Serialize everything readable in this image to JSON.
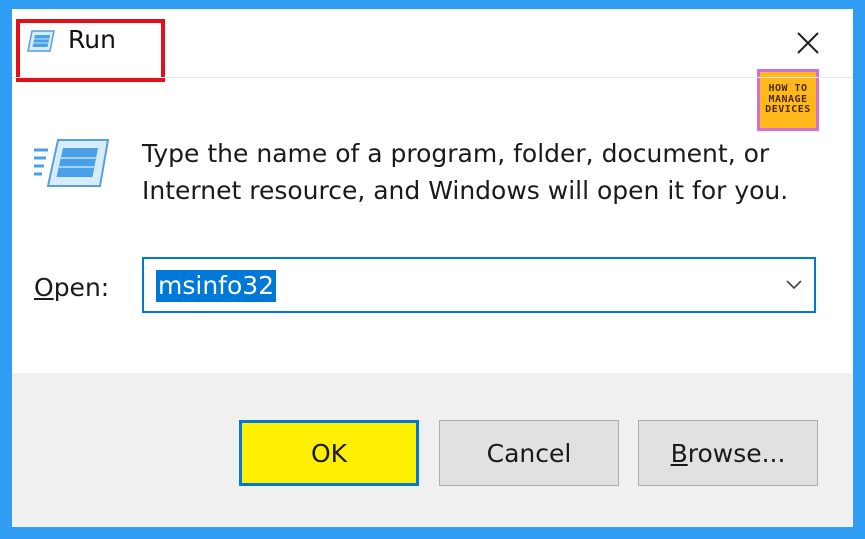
{
  "window": {
    "title": "Run",
    "close_icon": "close-icon"
  },
  "watermark": {
    "line1": "HOW TO",
    "line2": "MANAGE",
    "line3": "DEVICES"
  },
  "message": {
    "line1": "Type the name of a program, folder, document, or",
    "line2": "Internet resource, and Windows will open it for you."
  },
  "open": {
    "label_mnemonic": "O",
    "label_rest": "pen:",
    "value": "msinfo32",
    "dropdown_icon": "chevron-down-icon"
  },
  "buttons": {
    "ok": "OK",
    "cancel": "Cancel",
    "browse_mnemonic": "B",
    "browse_rest": "rowse..."
  },
  "colors": {
    "background": "#2f9df3",
    "highlight_border": "#e3101b",
    "ok_fill": "#fdf000",
    "accent": "#0078d7",
    "footer": "#f0f0f0"
  }
}
